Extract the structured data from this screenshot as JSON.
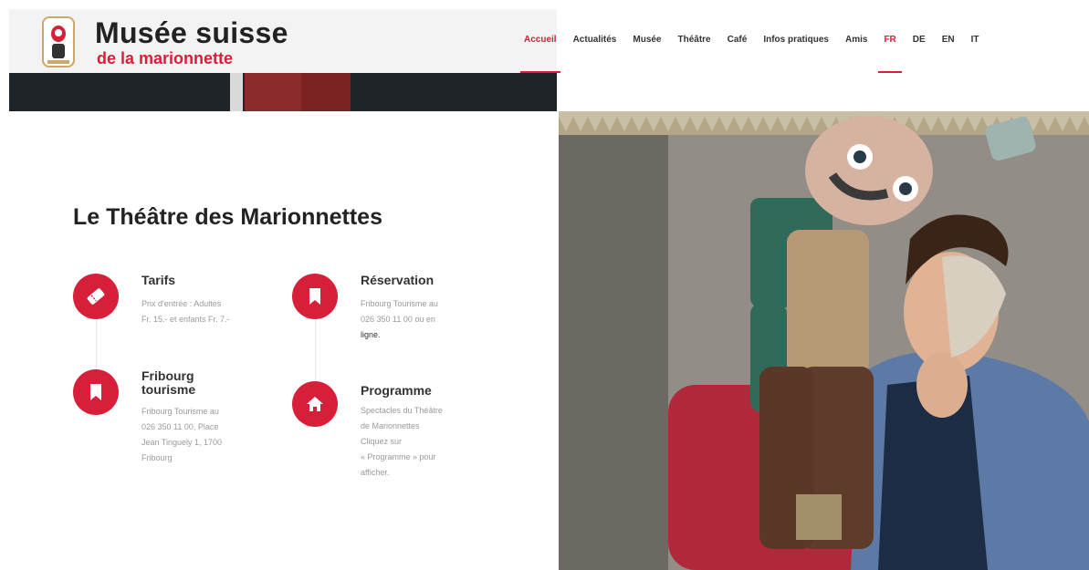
{
  "brand": {
    "name": "Musée suisse",
    "subtitle": "de la marionnette"
  },
  "nav": {
    "items": [
      "Accueil",
      "Actualités",
      "Musée",
      "Théâtre",
      "Café",
      "Infos pratiques",
      "Amis"
    ],
    "active_index": 0,
    "languages": [
      "FR",
      "DE",
      "EN",
      "IT"
    ],
    "active_language": "FR"
  },
  "main": {
    "title": "Le Théâtre des Marionnettes",
    "info_blocks": [
      {
        "label": "Tarifs",
        "icon": "ticket-icon",
        "lines": [
          "Prix d'entrée : Adultes",
          "Fr. 15.- et enfants Fr. 7.-"
        ]
      },
      {
        "label": "Réservation",
        "icon": "bookmark-icon",
        "lines": [
          "Fribourg Tourisme au",
          "026 350 11 00 ou en"
        ],
        "link": "ligne."
      },
      {
        "label_line1": "Fribourg",
        "label_line2": "tourisme",
        "icon": "bookmark-icon",
        "lines": [
          "Fribourg Tourisme au",
          "026 350 11 00, Place",
          "Jean Tinguely 1, 1700",
          "Fribourg"
        ]
      },
      {
        "label": "Programme",
        "icon": "home-icon",
        "lines": [
          "Spectacles du Théâtre",
          "de Marionnettes",
          "Cliquez sur",
          "« Programme » pour",
          "afficher."
        ]
      }
    ]
  },
  "colors": {
    "accent": "#d71f3a",
    "header_bg": "#f3f3f3",
    "text": "#222222",
    "muted": "#9a9a9a"
  }
}
